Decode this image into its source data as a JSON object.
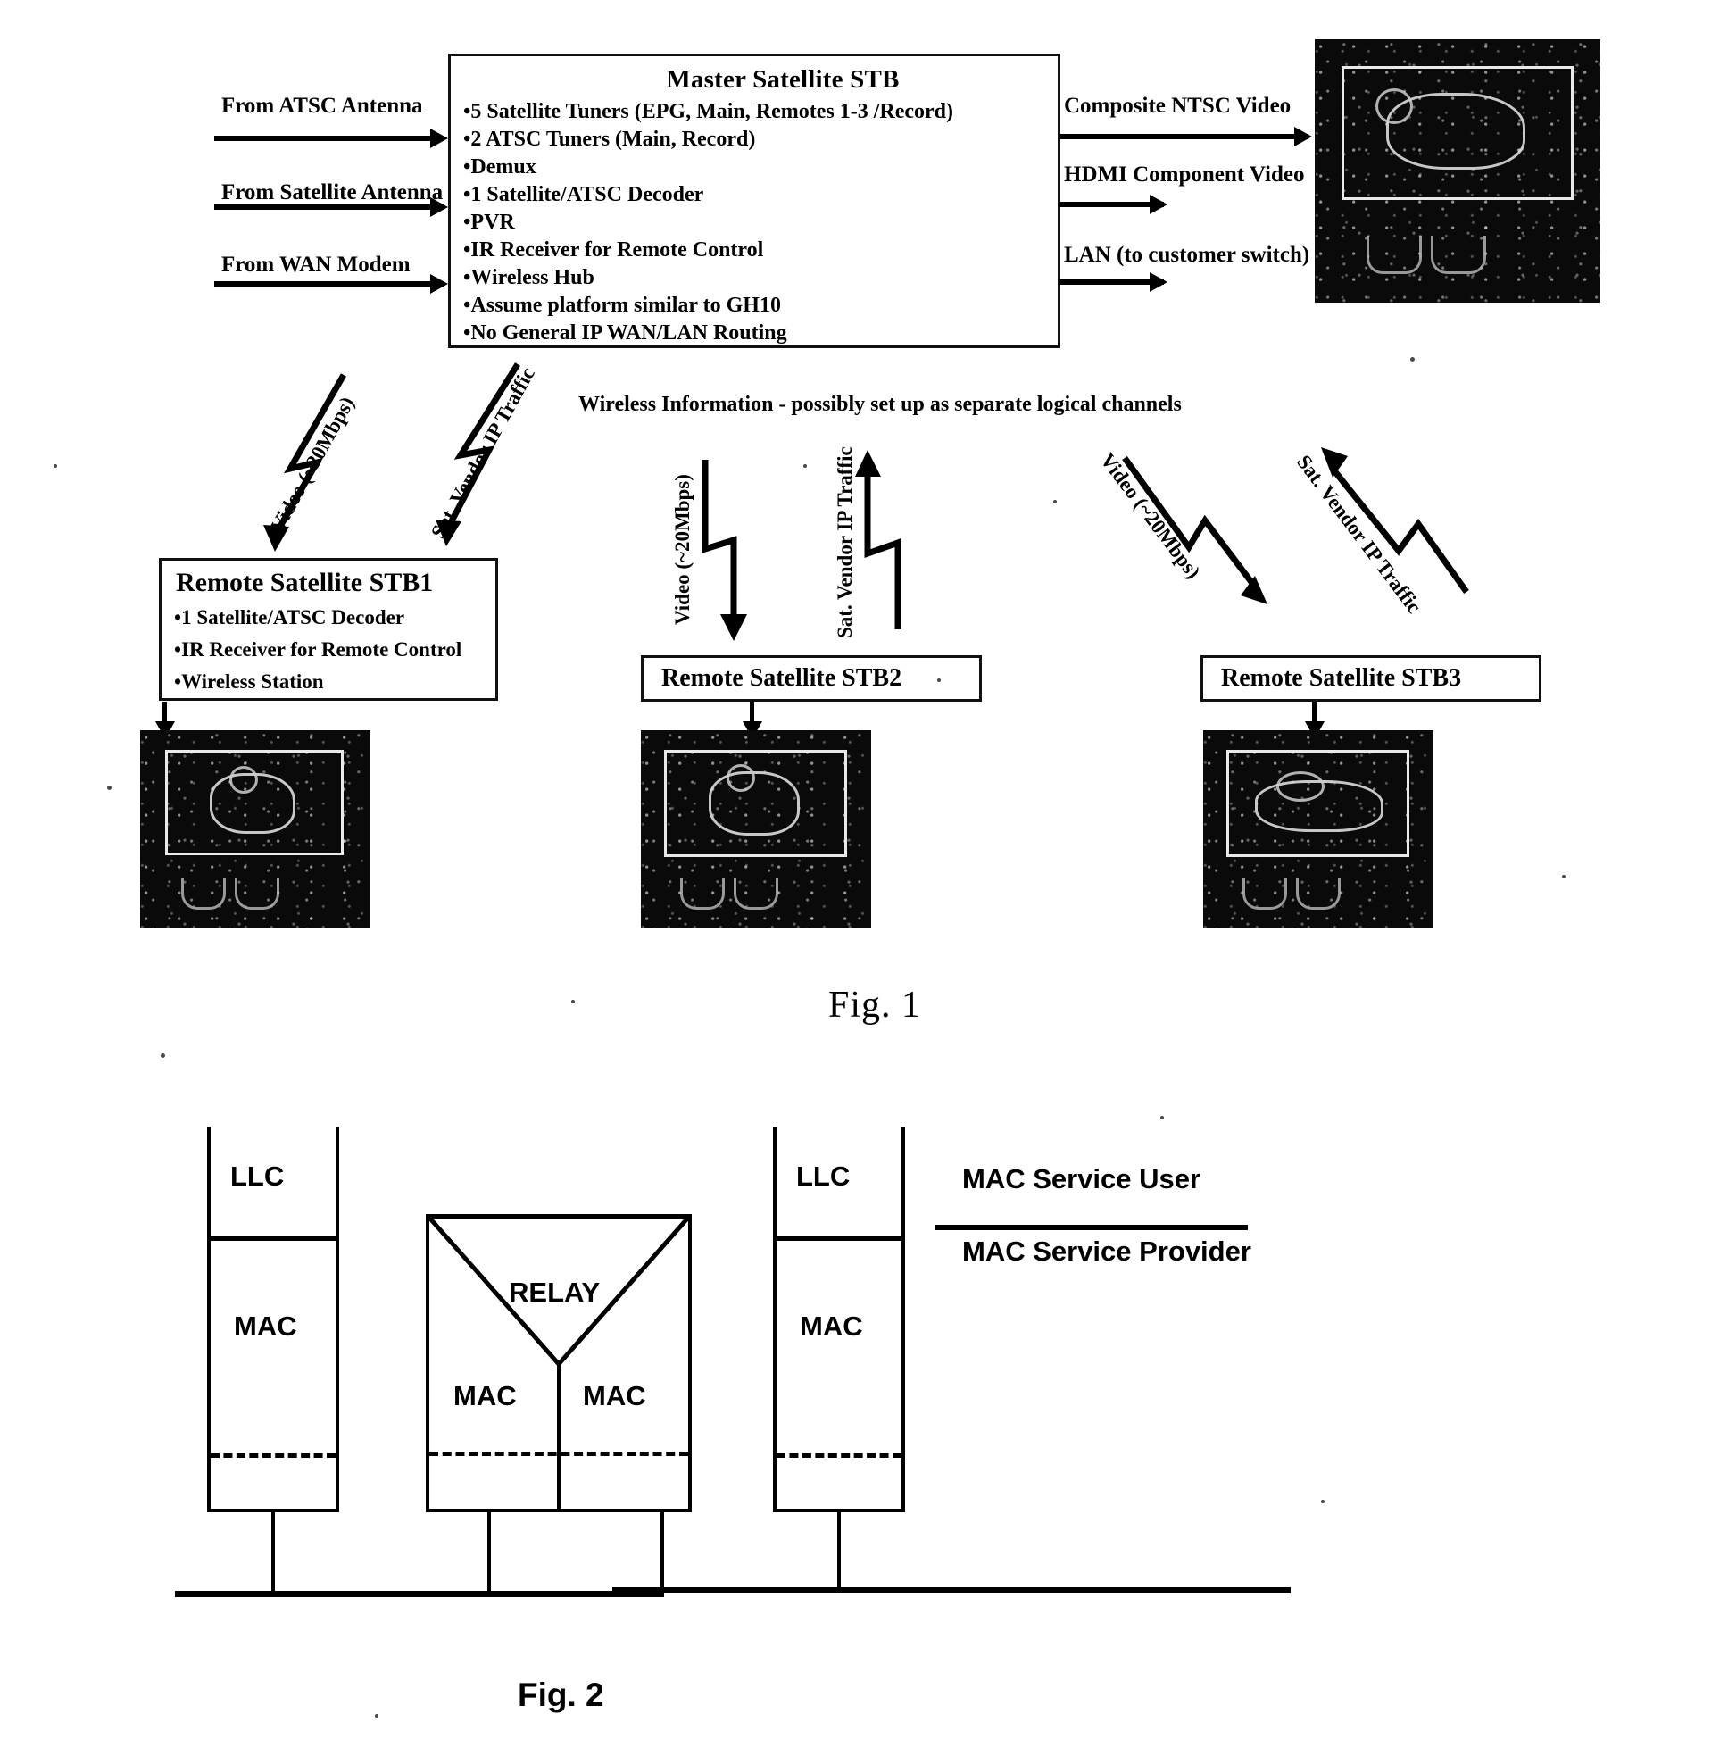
{
  "figure1": {
    "caption": "Fig. 1",
    "master_box": {
      "title": "Master Satellite STB",
      "bullets": [
        "5 Satellite Tuners (EPG, Main, Remotes 1-3 /Record)",
        "2 ATSC Tuners (Main, Record)",
        "Demux",
        "1 Satellite/ATSC Decoder",
        "PVR",
        "IR Receiver for Remote Control",
        "Wireless Hub",
        "Assume platform similar to GH10",
        "No General IP WAN/LAN Routing"
      ]
    },
    "inputs": [
      "From ATSC Antenna",
      "From Satellite Antenna",
      "From WAN Modem"
    ],
    "outputs": [
      "Composite NTSC Video",
      "HDMI Component Video",
      "LAN (to customer switch)"
    ],
    "wireless_note": "Wireless Information - possibly set up as separate logical channels",
    "stb1": {
      "title": "Remote Satellite STB1",
      "bullets": [
        "1 Satellite/ATSC Decoder",
        "IR Receiver for Remote Control",
        "Wireless Station"
      ]
    },
    "stb2": {
      "title": "Remote Satellite STB2"
    },
    "stb3": {
      "title": "Remote Satellite STB3"
    },
    "link_labels": {
      "video_1": "Video (~20Mbps)",
      "sat_ip_1": "Sat. Vendor IP Traffic",
      "video_2": "Video (~20Mbps)",
      "sat_ip_2": "Sat. Vendor IP Traffic",
      "video_3": "Video (~20Mbps)",
      "sat_ip_3": "Sat. Vendor IP Traffic"
    }
  },
  "figure2": {
    "caption": "Fig. 2",
    "left_stack": {
      "upper": "LLC",
      "lower": "MAC"
    },
    "middle_stack": {
      "top": "RELAY",
      "left_lower": "MAC",
      "right_lower": "MAC"
    },
    "right_stack": {
      "upper": "LLC",
      "lower": "MAC"
    },
    "side_labels": {
      "upper": "MAC Service User",
      "lower": "MAC Service Provider"
    }
  },
  "colors": {
    "ink": "#111111",
    "paper": "#ffffff",
    "screen": "#0a0a0a"
  }
}
